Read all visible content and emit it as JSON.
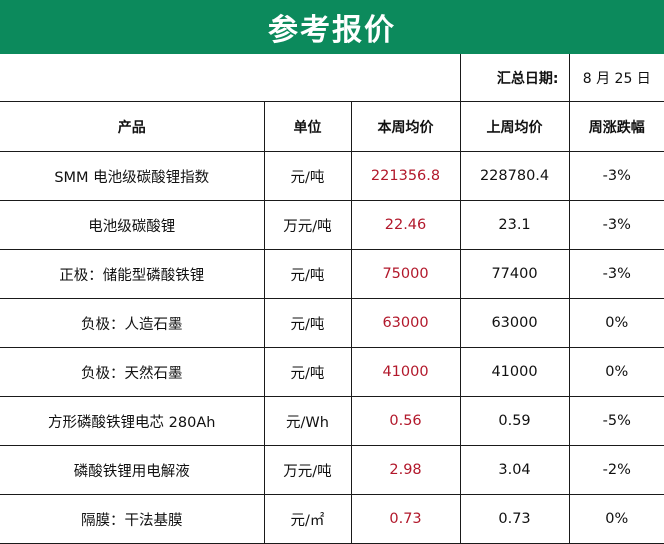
{
  "title": "参考报价",
  "summary": {
    "label": "汇总日期:",
    "value": "8 月 25 日"
  },
  "headers": [
    "产品",
    "单位",
    "本周均价",
    "上周均价",
    "周涨跌幅"
  ],
  "rows": [
    {
      "product": "SMM 电池级碳酸锂指数",
      "unit": "元/吨",
      "this_week": "221356.8",
      "last_week": "228780.4",
      "change": "-3%"
    },
    {
      "product": "电池级碳酸锂",
      "unit": "万元/吨",
      "this_week": "22.46",
      "last_week": "23.1",
      "change": "-3%"
    },
    {
      "product": "正极：储能型磷酸铁锂",
      "unit": "元/吨",
      "this_week": "75000",
      "last_week": "77400",
      "change": "-3%"
    },
    {
      "product": "负极：人造石墨",
      "unit": "元/吨",
      "this_week": "63000",
      "last_week": "63000",
      "change": "0%"
    },
    {
      "product": "负极：天然石墨",
      "unit": "元/吨",
      "this_week": "41000",
      "last_week": "41000",
      "change": "0%"
    },
    {
      "product": "方形磷酸铁锂电芯 280Ah",
      "unit": "元/Wh",
      "this_week": "0.56",
      "last_week": "0.59",
      "change": "-5%"
    },
    {
      "product": "磷酸铁锂用电解液",
      "unit": "万元/吨",
      "this_week": "2.98",
      "last_week": "3.04",
      "change": "-2%"
    },
    {
      "product": "隔膜：干法基膜",
      "unit": "元/㎡",
      "this_week": "0.73",
      "last_week": "0.73",
      "change": "0%"
    }
  ],
  "colors": {
    "banner": "#0c8a5c",
    "this_week_text": "#b2182b"
  }
}
